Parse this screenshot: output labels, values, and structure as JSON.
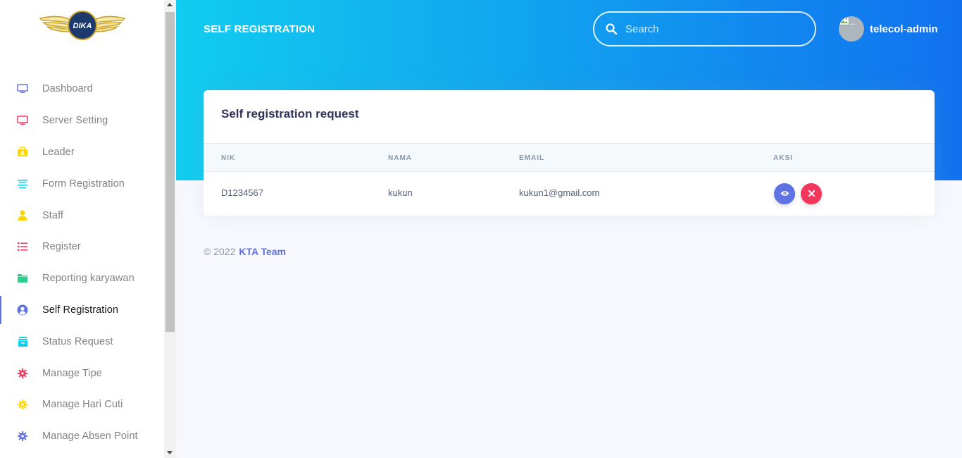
{
  "brand": {
    "logo_text": "DIKA"
  },
  "sidebar": {
    "items": [
      {
        "label": "Dashboard",
        "icon": "monitor-icon",
        "color": "#5e72e4"
      },
      {
        "label": "Server Setting",
        "icon": "monitor-icon",
        "color": "#f5365c"
      },
      {
        "label": "Leader",
        "icon": "briefcase-icon",
        "color": "#ffd600"
      },
      {
        "label": "Form Registration",
        "icon": "align-center-icon",
        "color": "#11cdef"
      },
      {
        "label": "Staff",
        "icon": "user-icon",
        "color": "#ffd600"
      },
      {
        "label": "Register",
        "icon": "bullet-list-icon",
        "color": "#f5365c"
      },
      {
        "label": "Reporting karyawan",
        "icon": "folder-icon",
        "color": "#2dce89"
      },
      {
        "label": "Self Registration",
        "icon": "user-circle-icon",
        "color": "#5e72e4",
        "active": true
      },
      {
        "label": "Status Request",
        "icon": "archive-icon",
        "color": "#11cdef"
      },
      {
        "label": "Manage Tipe",
        "icon": "gear-icon",
        "color": "#f5365c"
      },
      {
        "label": "Manage Hari Cuti",
        "icon": "gear-icon",
        "color": "#ffd600"
      },
      {
        "label": "Manage Absen Point",
        "icon": "gear-icon",
        "color": "#5e72e4"
      }
    ]
  },
  "header": {
    "title": "SELF REGISTRATION",
    "search_placeholder": "Search",
    "username": "telecol-admin"
  },
  "card": {
    "title": "Self registration request",
    "columns": [
      "NIK",
      "NAMA",
      "EMAIL",
      "AKSI"
    ],
    "rows": [
      {
        "nik": "D1234567",
        "nama": "kukun",
        "email": "kukun1@gmail.com"
      }
    ]
  },
  "footer": {
    "copyright": "© 2022",
    "link": "KTA Team"
  },
  "colors": {
    "primary": "#5e72e4",
    "danger": "#f5365c",
    "header_gradient_start": "#11cdef",
    "header_gradient_end": "#1171ef"
  }
}
